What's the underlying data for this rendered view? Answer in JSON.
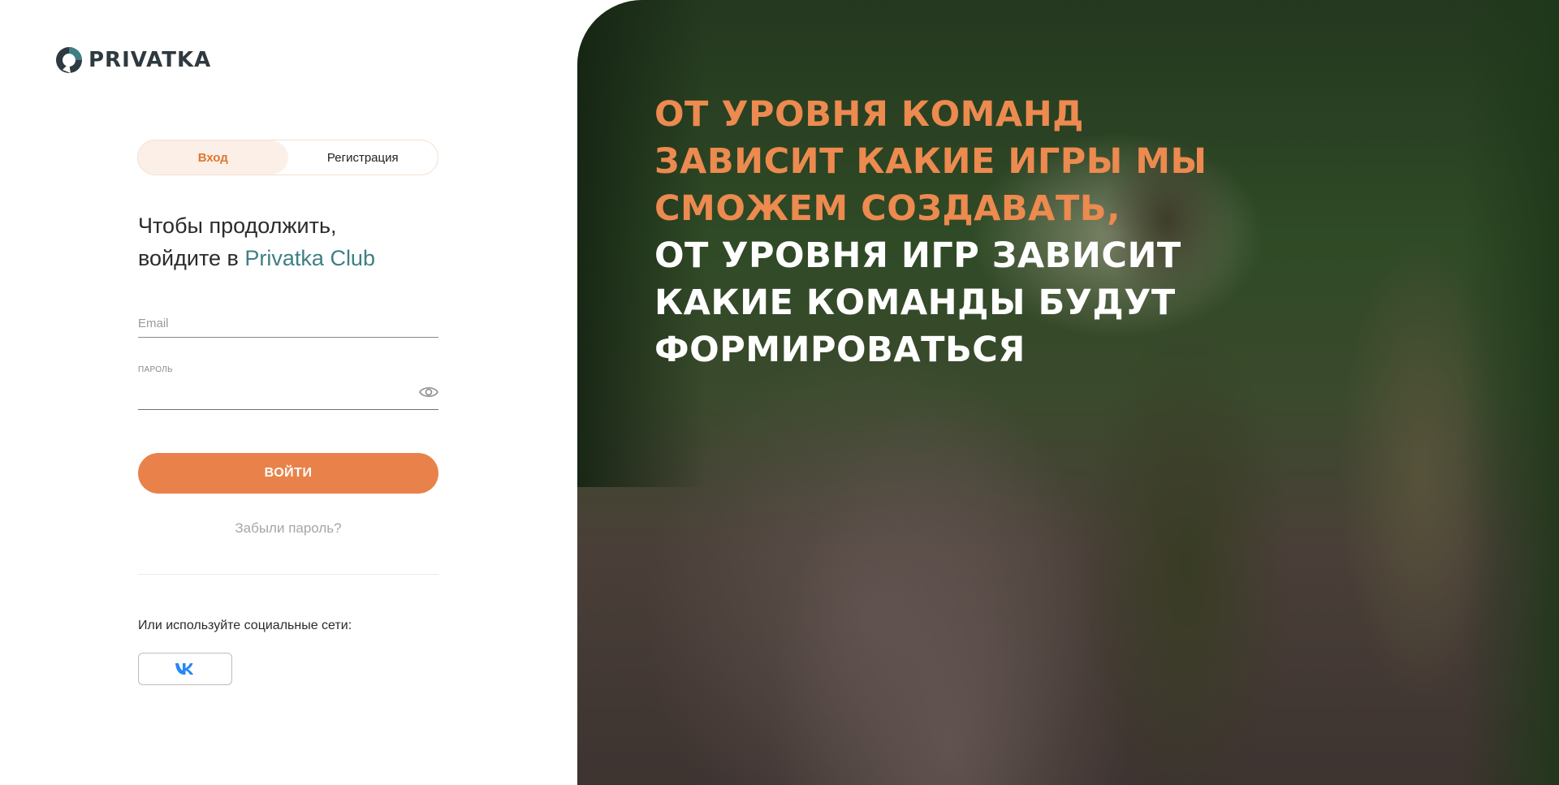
{
  "brand": {
    "logo_text": "PRIVATKA"
  },
  "tabs": [
    {
      "label": "Вход",
      "active": true
    },
    {
      "label": "Регистрация",
      "active": false
    }
  ],
  "heading": {
    "line1": "Чтобы продолжить,",
    "line2_prefix": "войдите в ",
    "line2_brand": "Privatka Club"
  },
  "form": {
    "email_placeholder": "Email",
    "password_label": "ПАРОЛЬ",
    "login_button": "ВОЙТИ",
    "forgot_link": "Забыли пароль?"
  },
  "social": {
    "label": "Или используйте социальные сети:",
    "vk_icon": "vk-icon"
  },
  "slogan": {
    "orange_lines": [
      "ОТ УРОВНЯ КОМАНД",
      "ЗАВИСИТ КАКИЕ ИГРЫ МЫ",
      "СМОЖЕМ СОЗДАВАТЬ,"
    ],
    "white_lines": [
      "ОТ УРОВНЯ ИГР ЗАВИСИТ",
      "КАКИЕ КОМАНДЫ БУДУТ",
      "ФОРМИРОВАТЬСЯ"
    ]
  },
  "colors": {
    "accent": "#e8824a",
    "brand_teal": "#3e7f84",
    "tab_active_bg": "#fbefe7"
  }
}
